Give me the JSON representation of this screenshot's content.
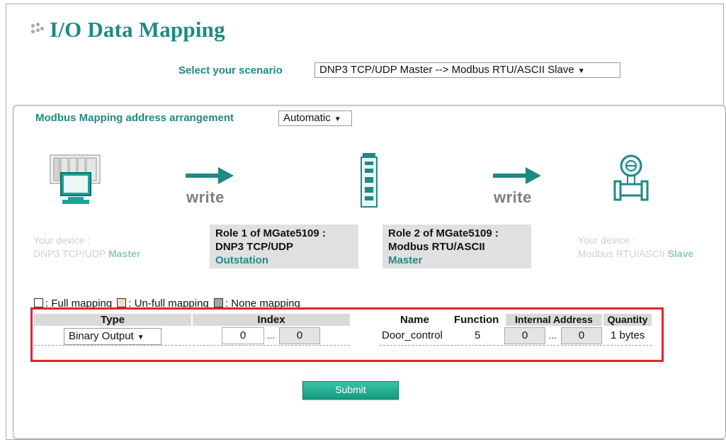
{
  "page": {
    "title": "I/O Data Mapping"
  },
  "scenario": {
    "label": "Select your scenario",
    "selected": "DNP3 TCP/UDP Master --> Modbus RTU/ASCII Slave"
  },
  "arrangement": {
    "label": "Modbus Mapping address arrangement",
    "selected": "Automatic"
  },
  "diagram": {
    "write_label_1": "write",
    "write_label_2": "write",
    "left_device": {
      "line1": "Your device :",
      "line2": "DNP3 TCP/UDP",
      "role": "Master"
    },
    "role1": {
      "line1": "Role 1 of MGate5109 :",
      "line2": "DNP3 TCP/UDP",
      "role": "Outstation"
    },
    "role2": {
      "line1": "Role 2 of MGate5109 :",
      "line2": "Modbus RTU/ASCII",
      "role": "Master"
    },
    "right_device": {
      "line1": "Your device :",
      "line2": "Modbus RTU/ASCII",
      "role": "Slave"
    }
  },
  "legend": {
    "full": ": Full mapping",
    "unfull": ": Un-full mapping",
    "none": ": None mapping",
    "colors": {
      "full": "#ffffff",
      "unfull": "#f3dcc4",
      "none": "#a6a6a6"
    }
  },
  "table": {
    "headers": {
      "type": "Type",
      "index": "Index",
      "name": "Name",
      "function": "Function",
      "internal_address": "Internal Address",
      "quantity": "Quantity"
    },
    "row": {
      "type": "Binary Output",
      "index_start": "0",
      "index_sep": "...",
      "index_end": "0",
      "name": "Door_control",
      "function": "5",
      "addr_start": "0",
      "addr_sep": "...",
      "addr_end": "0",
      "quantity": "1 bytes"
    }
  },
  "submit_label": "Submit",
  "colors": {
    "accent": "#1f8a83",
    "highlight": "#e0232e"
  }
}
